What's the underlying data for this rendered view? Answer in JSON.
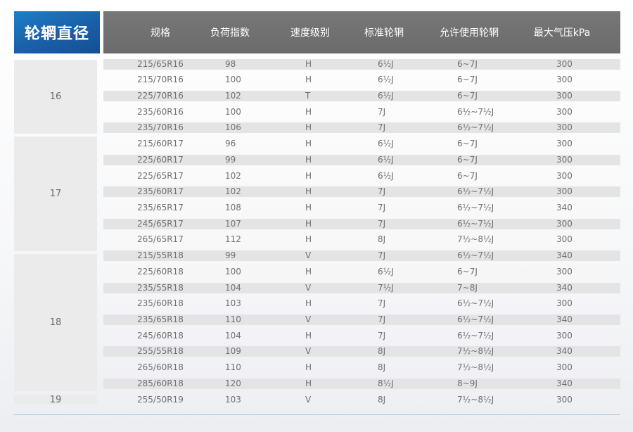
{
  "title": "轮辋直径",
  "columns": [
    "规格",
    "负荷指数",
    "速度级别",
    "标准轮辋",
    "允许使用轮辋",
    "最大气压kPa"
  ],
  "groups": [
    {
      "label": "16",
      "rows": [
        [
          "215/65R16",
          "98",
          "H",
          "6½J",
          "6~7J",
          "300"
        ],
        [
          "215/70R16",
          "100",
          "H",
          "6½J",
          "6~7J",
          "300"
        ],
        [
          "225/70R16",
          "102",
          "T",
          "6½J",
          "6~7J",
          "300"
        ],
        [
          "235/60R16",
          "100",
          "H",
          "7J",
          "6½~7½J",
          "300"
        ],
        [
          "235/70R16",
          "106",
          "H",
          "7J",
          "6½~7½J",
          "300"
        ]
      ]
    },
    {
      "label": "17",
      "rows": [
        [
          "215/60R17",
          "96",
          "H",
          "6½J",
          "6~7J",
          "300"
        ],
        [
          "225/60R17",
          "99",
          "H",
          "6½J",
          "6~7J",
          "300"
        ],
        [
          "225/65R17",
          "102",
          "H",
          "6½J",
          "6~7J",
          "300"
        ],
        [
          "235/60R17",
          "102",
          "H",
          "7J",
          "6½~7½J",
          "300"
        ],
        [
          "235/65R17",
          "108",
          "H",
          "7J",
          "6½~7½J",
          "340"
        ],
        [
          "245/65R17",
          "107",
          "H",
          "7J",
          "6½~7½J",
          "300"
        ],
        [
          "265/65R17",
          "112",
          "H",
          "8J",
          "7½~8½J",
          "300"
        ]
      ]
    },
    {
      "label": "18",
      "rows": [
        [
          "215/55R18",
          "99",
          "V",
          "7J",
          "6½~7½J",
          "340"
        ],
        [
          "225/60R18",
          "100",
          "H",
          "6½J",
          "6~7J",
          "300"
        ],
        [
          "235/55R18",
          "104",
          "V",
          "7½J",
          "7~8J",
          "340"
        ],
        [
          "235/60R18",
          "103",
          "H",
          "7J",
          "6½~7½J",
          "300"
        ],
        [
          "235/65R18",
          "110",
          "V",
          "7J",
          "6½~7½J",
          "340"
        ],
        [
          "245/60R18",
          "104",
          "H",
          "7J",
          "6½~7½J",
          "300"
        ],
        [
          "255/55R18",
          "109",
          "V",
          "8J",
          "7½~8½J",
          "340"
        ],
        [
          "265/60R18",
          "110",
          "H",
          "8J",
          "7½~8½J",
          "300"
        ],
        [
          "285/60R18",
          "120",
          "H",
          "8½J",
          "8~9J",
          "340"
        ]
      ]
    },
    {
      "label": "19",
      "rows": [
        [
          "255/50R19",
          "103",
          "V",
          "8J",
          "7½~8½J",
          "300"
        ]
      ]
    }
  ]
}
